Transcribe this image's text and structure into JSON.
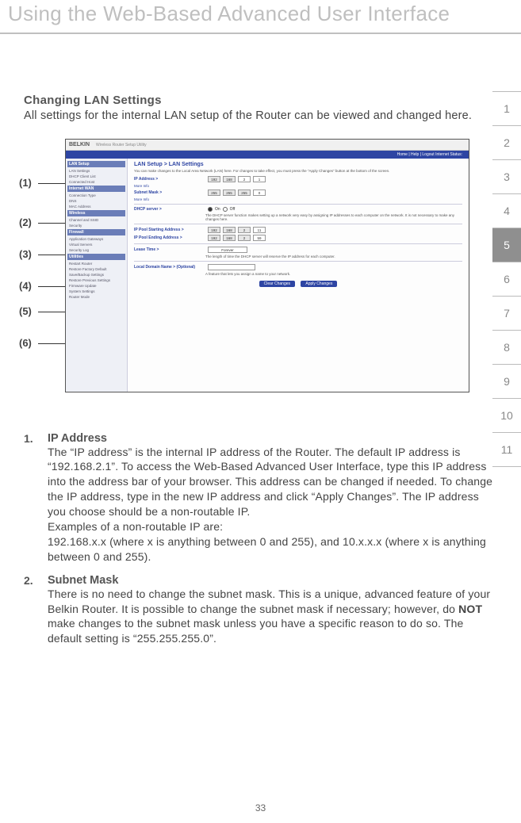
{
  "page_title": "Using the Web-Based Advanced User Interface",
  "page_number": "33",
  "section": {
    "heading": "Changing LAN Settings",
    "intro": "All settings for the internal LAN setup of the Router can be viewed and changed here."
  },
  "callouts": [
    "(1)",
    "(2)",
    "(3)",
    "(4)",
    "(5)",
    "(6)"
  ],
  "screenshot": {
    "brand": "BELKIN",
    "brand_sub": "Wireless Router Setup Utility",
    "top_right": "Home | Help | Logout     Internet Status:",
    "breadcrumb": "LAN Setup > LAN Settings",
    "desc": "You can make changes to the Local Area Network (LAN) here. For changes to take effect, you must press the \"Apply Changes\" button at the bottom of the screen.",
    "sidebar": {
      "cats": [
        "LAN Setup",
        "Internet WAN",
        "Wireless",
        "Firewall",
        "Utilities"
      ],
      "items_lan": [
        "LAN Settings",
        "DHCP Client List",
        "Connected Host"
      ],
      "items_wan": [
        "Connection Type",
        "DNS",
        "MAC Address"
      ],
      "items_wireless": [
        "Channel and SSID",
        "Security"
      ],
      "items_firewall": [
        "Application Gateways",
        "Virtual Servers",
        "Security Log"
      ],
      "items_util": [
        "Restart Router",
        "Restore Factory Default",
        "Save/Backup Settings",
        "Restore Previous Settings",
        "Firmware Update",
        "System Settings",
        "Router Mode"
      ]
    },
    "rows": {
      "ip_label": "IP Address >",
      "ip": [
        "192",
        "168",
        "2",
        "1"
      ],
      "subnet_label": "Subnet Mask >",
      "subnet": [
        "255",
        "255",
        "255",
        "0"
      ],
      "dhcp_label": "DHCP server >",
      "dhcp_on": "On",
      "dhcp_off": "Off",
      "dhcp_desc": "The DHCP server function makes setting up a network very easy by assigning IP addresses to each computer on the network. It is not necessary to make any changes here.",
      "pool_start_label": "IP Pool Starting Address >",
      "pool_start": [
        "192",
        "168",
        "2",
        "11"
      ],
      "pool_end_label": "IP Pool Ending Address >",
      "pool_end": [
        "192",
        "168",
        "2",
        "59"
      ],
      "lease_label": "Lease Time >",
      "lease_value": "Forever",
      "lease_desc": "The length of time the DHCP server will reserve the IP address for each computer.",
      "domain_label": "Local Domain Name > (Optional)",
      "domain_desc": "A feature that lets you assign a name to your network.",
      "more_info": "More Info"
    },
    "buttons": {
      "clear": "Clear Changes",
      "apply": "Apply Changes"
    }
  },
  "items": [
    {
      "num": "1.",
      "title": "IP Address",
      "para1": "The “IP address” is the internal IP address of the Router. The default IP address is “192.168.2.1”. To access the Web-Based Advanced User Interface, type this IP address into the address bar of your browser. This address can be changed if needed. To change the IP address, type in the new IP address and click “Apply Changes”. The IP address you choose should be a non-routable IP.",
      "para2": "Examples of a non-routable IP are:",
      "para3": "192.168.x.x (where x is anything between 0 and 255), and 10.x.x.x (where x is anything between 0 and 255)."
    },
    {
      "num": "2.",
      "title": "Subnet Mask",
      "para1_pre": "There is no need to change the subnet mask. This is a unique, advanced feature of your Belkin Router. It is possible to change the subnet mask if necessary; however, do ",
      "para1_bold": "NOT",
      "para1_post": " make changes to the subnet mask unless you have a specific reason to do so. The default setting is “255.255.255.0”."
    }
  ],
  "tabs": [
    "1",
    "2",
    "3",
    "4",
    "5",
    "6",
    "7",
    "8",
    "9",
    "10",
    "11"
  ],
  "active_tab": "5"
}
